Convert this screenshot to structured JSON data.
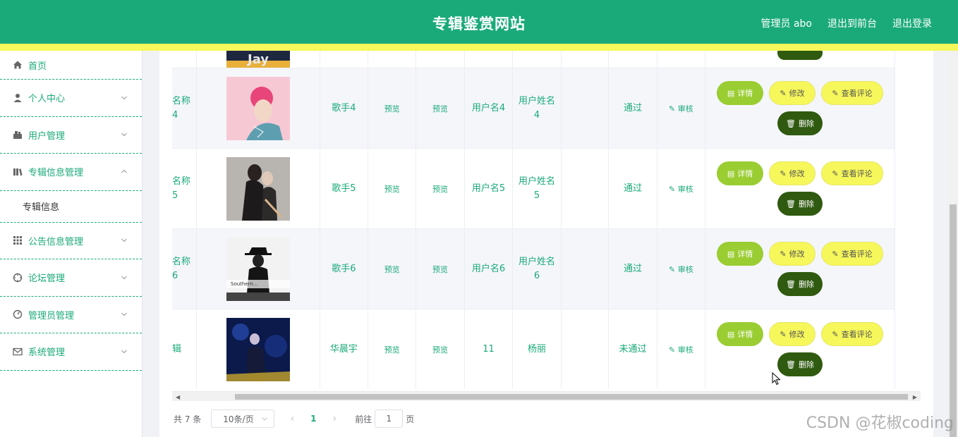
{
  "header": {
    "title": "专辑鉴赏网站",
    "admin_label": "管理员 abo",
    "to_front": "退出到前台",
    "logout": "退出登录"
  },
  "sidebar": {
    "items": [
      {
        "label": "首页",
        "icon": "home-icon"
      },
      {
        "label": "个人中心",
        "icon": "user-icon"
      },
      {
        "label": "用户管理",
        "icon": "users-icon"
      },
      {
        "label": "专辑信息管理",
        "icon": "album-icon"
      },
      {
        "label": "公告信息管理",
        "icon": "grid-icon"
      },
      {
        "label": "论坛管理",
        "icon": "compass-icon"
      },
      {
        "label": "管理员管理",
        "icon": "gauge-icon"
      },
      {
        "label": "系统管理",
        "icon": "mail-icon"
      }
    ],
    "sub_item": "专辑信息"
  },
  "table": {
    "rows": [
      {
        "name": "名称\n4",
        "singer": "歌手4",
        "preview1": "预览",
        "preview2": "预览",
        "username": "用户名4",
        "realname": "用户姓名\n4",
        "status": "通过",
        "audit": "审核",
        "striped": true
      },
      {
        "name": "名称\n5",
        "singer": "歌手5",
        "preview1": "预览",
        "preview2": "预览",
        "username": "用户名5",
        "realname": "用户姓名\n5",
        "status": "通过",
        "audit": "审核",
        "striped": false
      },
      {
        "name": "名称\n6",
        "singer": "歌手6",
        "preview1": "预览",
        "preview2": "预览",
        "username": "用户名6",
        "realname": "用户姓名\n6",
        "status": "通过",
        "audit": "审核",
        "striped": true
      },
      {
        "name": "辑",
        "singer": "华晨宇",
        "preview1": "预览",
        "preview2": "预览",
        "username": "11",
        "realname": "杨丽",
        "status": "未通过",
        "audit": "审核",
        "striped": false
      }
    ],
    "buttons": {
      "detail": "详情",
      "edit": "修改",
      "comment": "查看评论",
      "delete": "删除"
    },
    "colors": {
      "detail": "#9acd32",
      "edit": "#f6f75a",
      "delete": "#2f5a10"
    }
  },
  "pager": {
    "total": "共 7 条",
    "page_size": "10条/页",
    "current": "1",
    "goto_label": "前往",
    "goto_value": "1",
    "goto_suffix": "页"
  },
  "watermark": "CSDN @花椒coding",
  "theme": {
    "primary": "#1aaa7a",
    "accent": "#f6f75a"
  }
}
